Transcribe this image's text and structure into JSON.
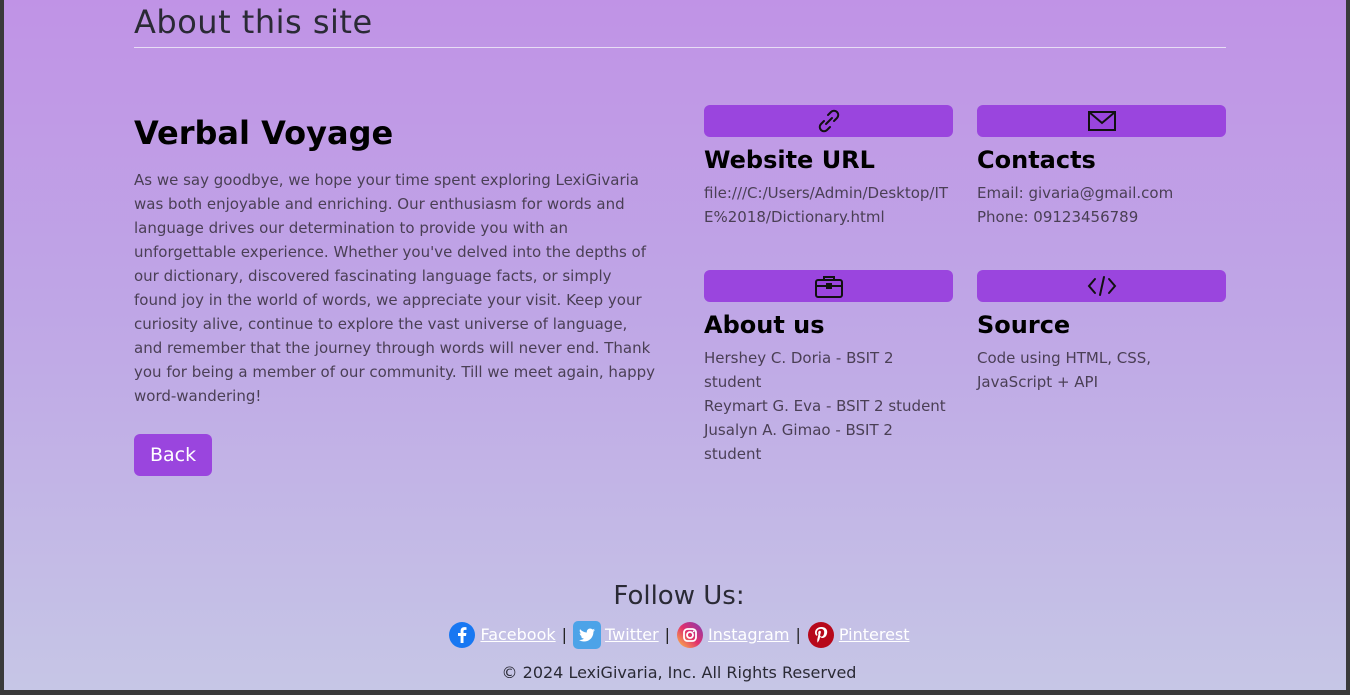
{
  "header": {
    "title": "About this site"
  },
  "intro": {
    "title": "Verbal Voyage",
    "text": "As we say goodbye, we hope your time spent exploring LexiGivaria was both enjoyable and enriching. Our enthusiasm for words and language drives our determination to provide you with an unforgettable experience. Whether you've delved into the depths of our dictionary, discovered fascinating language facts, or simply found joy in the world of words, we appreciate your visit. Keep your curiosity alive, continue to explore the vast universe of language, and remember that the journey through words will never end. Thank you for being a member of our community. Till we meet again, happy word-wandering!",
    "back_label": "Back"
  },
  "cards": {
    "website": {
      "icon": "link-icon",
      "title": "Website URL",
      "line1": "file:///C:/Users/Admin/Desktop/ITE%2018/Dictionary.html"
    },
    "contacts": {
      "icon": "envelope-icon",
      "title": "Contacts",
      "line1": "Email: givaria@gmail.com",
      "line2": "Phone: 09123456789"
    },
    "about": {
      "icon": "briefcase-icon",
      "title": "About us",
      "line1": "Hershey C. Doria - BSIT 2 student",
      "line2": "Reymart G. Eva - BSIT 2 student",
      "line3": "Jusalyn A. Gimao - BSIT 2 student"
    },
    "source": {
      "icon": "code-icon",
      "title": "Source",
      "line1": "Code using HTML, CSS, JavaScript + API"
    }
  },
  "footer": {
    "follow_title": "Follow Us:",
    "links": [
      {
        "label": " Facebook",
        "icon": "facebook-icon"
      },
      {
        "label": " Twitter",
        "icon": "twitter-icon"
      },
      {
        "label": " Instagram",
        "icon": "instagram-icon"
      },
      {
        "label": " Pinterest",
        "icon": "pinterest-icon"
      }
    ],
    "separator": "|",
    "copyright": "© 2024 LexiGivaria, Inc. All Rights Reserved"
  },
  "colors": {
    "accent": "#9a45de",
    "bg_top": "#c093e6",
    "bg_bottom": "#c6c6e6"
  }
}
